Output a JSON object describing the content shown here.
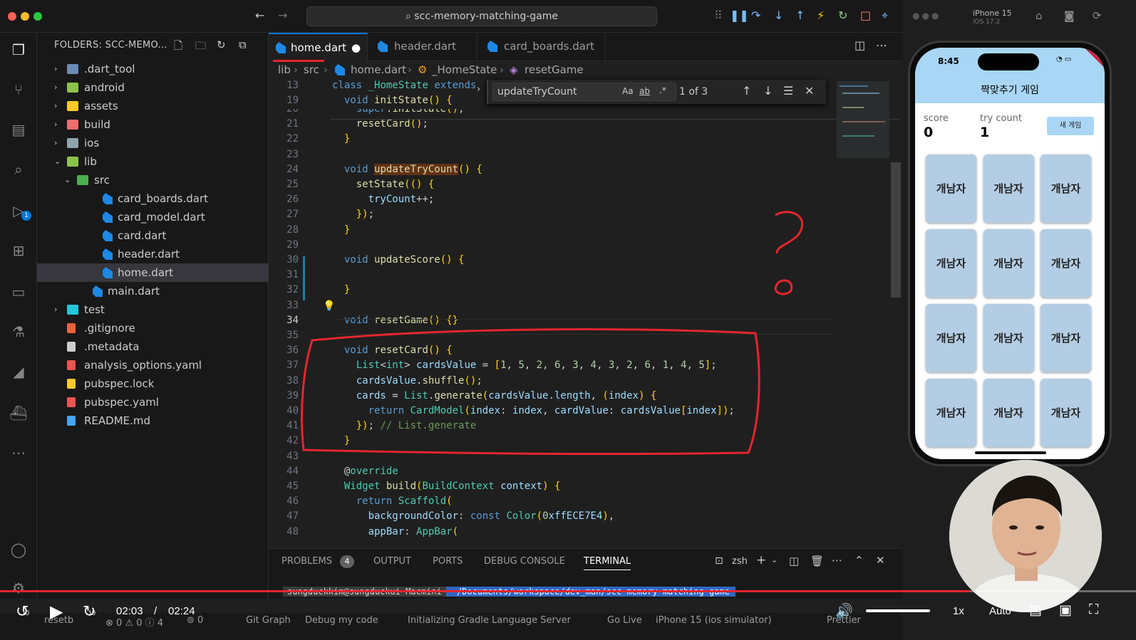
{
  "window": {
    "search_title": "scc-memory-matching-game"
  },
  "sidebar": {
    "title": "FOLDERS: SCC-MEMO...",
    "tree": [
      {
        "label": ".dart_tool",
        "kind": "folder",
        "expanded": false,
        "indent": 0
      },
      {
        "label": "android",
        "kind": "folder",
        "expanded": false,
        "indent": 0
      },
      {
        "label": "assets",
        "kind": "folder",
        "expanded": false,
        "indent": 0
      },
      {
        "label": "build",
        "kind": "folder",
        "expanded": false,
        "indent": 0
      },
      {
        "label": "ios",
        "kind": "folder",
        "expanded": false,
        "indent": 0
      },
      {
        "label": "lib",
        "kind": "folder",
        "expanded": true,
        "indent": 0
      },
      {
        "label": "src",
        "kind": "folder",
        "expanded": true,
        "indent": 1
      },
      {
        "label": "card_boards.dart",
        "kind": "dart",
        "indent": 2
      },
      {
        "label": "card_model.dart",
        "kind": "dart",
        "indent": 2
      },
      {
        "label": "card.dart",
        "kind": "dart",
        "indent": 2
      },
      {
        "label": "header.dart",
        "kind": "dart",
        "indent": 2
      },
      {
        "label": "home.dart",
        "kind": "dart",
        "indent": 2,
        "selected": true
      },
      {
        "label": "main.dart",
        "kind": "dart",
        "indent": 1
      },
      {
        "label": "test",
        "kind": "folder",
        "expanded": false,
        "indent": 0
      },
      {
        "label": ".gitignore",
        "kind": "file",
        "indent": 0
      },
      {
        "label": ".metadata",
        "kind": "file",
        "indent": 0
      },
      {
        "label": "analysis_options.yaml",
        "kind": "file",
        "indent": 0
      },
      {
        "label": "pubspec.lock",
        "kind": "file",
        "indent": 0
      },
      {
        "label": "pubspec.yaml",
        "kind": "file",
        "indent": 0
      },
      {
        "label": "README.md",
        "kind": "file",
        "indent": 0
      }
    ]
  },
  "tabs": [
    {
      "label": "home.dart",
      "active": true,
      "modified": true
    },
    {
      "label": "header.dart",
      "active": false
    },
    {
      "label": "card_boards.dart",
      "active": false
    }
  ],
  "breadcrumb": [
    "lib",
    "src",
    "home.dart",
    "_HomeState",
    "resetGame"
  ],
  "find": {
    "query": "updateTryCount",
    "result": "1 of 3",
    "opt_case": "Aa",
    "opt_word": "ab",
    "opt_regex": ".*"
  },
  "code_lines": [
    {
      "n": "13",
      "t": "class _HomeState extends"
    },
    {
      "n": "19",
      "t": "  void initState() {"
    },
    {
      "n": "20",
      "t": "    super.initState();"
    },
    {
      "n": "21",
      "t": "    resetCard();"
    },
    {
      "n": "22",
      "t": "  }"
    },
    {
      "n": "23",
      "t": ""
    },
    {
      "n": "24",
      "t": "  void updateTryCount() {"
    },
    {
      "n": "25",
      "t": "    setState(() {"
    },
    {
      "n": "26",
      "t": "      tryCount++;"
    },
    {
      "n": "27",
      "t": "    });"
    },
    {
      "n": "28",
      "t": "  }"
    },
    {
      "n": "29",
      "t": ""
    },
    {
      "n": "30",
      "t": "  void updateScore() {"
    },
    {
      "n": "31",
      "t": ""
    },
    {
      "n": "32",
      "t": "  }"
    },
    {
      "n": "33",
      "t": ""
    },
    {
      "n": "34",
      "t": "  void resetGame() {}"
    },
    {
      "n": "35",
      "t": ""
    },
    {
      "n": "36",
      "t": "  void resetCard() {"
    },
    {
      "n": "37",
      "t": "    List<int> cardsValue = [1, 5, 2, 6, 3, 4, 3, 2, 6, 1, 4, 5];"
    },
    {
      "n": "38",
      "t": "    cardsValue.shuffle();"
    },
    {
      "n": "39",
      "t": "    cards = List.generate(cardsValue.length, (index) {"
    },
    {
      "n": "40",
      "t": "      return CardModel(index: index, cardValue: cardsValue[index]);"
    },
    {
      "n": "41",
      "t": "    }); // List.generate"
    },
    {
      "n": "42",
      "t": "  }"
    },
    {
      "n": "43",
      "t": ""
    },
    {
      "n": "44",
      "t": "  @override"
    },
    {
      "n": "45",
      "t": "  Widget build(BuildContext context) {"
    },
    {
      "n": "46",
      "t": "    return Scaffold("
    },
    {
      "n": "47",
      "t": "      backgroundColor: const Color(0xffECE7E4),"
    },
    {
      "n": "48",
      "t": "      appBar: AppBar("
    }
  ],
  "panel": {
    "tabs": [
      "PROBLEMS",
      "OUTPUT",
      "PORTS",
      "DEBUG CONSOLE",
      "TERMINAL"
    ],
    "problems_count": "4",
    "active_tab": "TERMINAL",
    "shell": "zsh",
    "prompt_user": "sungduckkim@sungduckui-Macmini",
    "prompt_path": "~/Documents/workspace/dev_man/scc-memory-matching-game"
  },
  "statusbar": {
    "branch": "resetb",
    "errors": "0",
    "warnings": "0",
    "info": "4",
    "ports": "0",
    "git_graph": "Git Graph",
    "debug": "Debug my code",
    "gradle": "Initializing Gradle Language Server",
    "golive": "Go Live",
    "device": "iPhone 15 (ios simulator)",
    "prettier": "Prettier"
  },
  "simulator": {
    "device": "iPhone 15",
    "os": "iOS 17.2",
    "time": "8:45",
    "app_title": "짝맞추기 게임",
    "score_label": "score",
    "score_value": "0",
    "try_label": "try count",
    "try_value": "1",
    "new_game_button": "새 게임",
    "debug_badge": "DEBUG",
    "card_face": "개남자",
    "card_count": 12
  },
  "player": {
    "current": "02:03",
    "separator": "/",
    "duration": "02:24",
    "speed": "1x",
    "quality": "Auto",
    "progress": 0.854,
    "skip_back": "10",
    "skip_fwd": "10"
  },
  "colors": {
    "accent": "#0078d4",
    "annotation": "#e3262e",
    "sim_header": "#a9d6f5",
    "card": "#b3cde4"
  }
}
